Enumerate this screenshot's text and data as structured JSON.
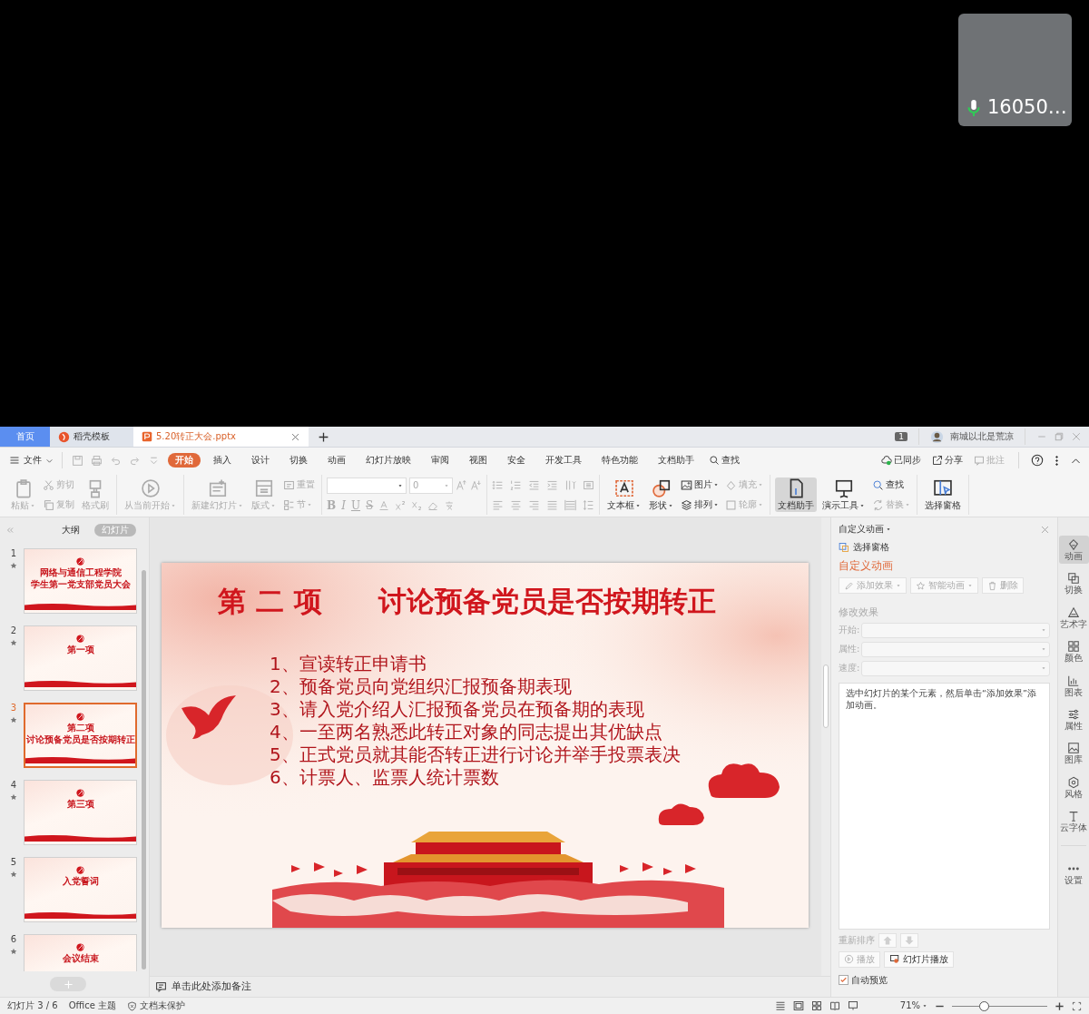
{
  "webcam": {
    "caption": "16050…"
  },
  "tabs": [
    {
      "label": "首页",
      "kind": "home",
      "selected": false
    },
    {
      "label": "稻壳模板",
      "kind": "docer",
      "selected": false
    },
    {
      "label": "5.20转正大会.pptx",
      "kind": "document",
      "selected": true
    }
  ],
  "account": {
    "badge": "1",
    "user": "南城以北是荒凉"
  },
  "menu": {
    "file": "文件",
    "items": [
      {
        "label": "开始",
        "selected": true
      },
      {
        "label": "插入",
        "selected": false
      },
      {
        "label": "设计",
        "selected": false
      },
      {
        "label": "切换",
        "selected": false
      },
      {
        "label": "动画",
        "selected": false
      },
      {
        "label": "幻灯片放映",
        "selected": false
      },
      {
        "label": "审阅",
        "selected": false
      },
      {
        "label": "视图",
        "selected": false
      },
      {
        "label": "安全",
        "selected": false
      },
      {
        "label": "开发工具",
        "selected": false
      },
      {
        "label": "特色功能",
        "selected": false
      },
      {
        "label": "文档助手",
        "selected": false
      }
    ],
    "search": "查找"
  },
  "menu_actions": [
    {
      "label": "已同步",
      "disabled": false
    },
    {
      "label": "分享",
      "disabled": false
    },
    {
      "label": "批注",
      "disabled": true
    }
  ],
  "ribbon": [
    {
      "kind": "buttons",
      "columns": [
        [
          {
            "label": "粘贴",
            "kind": "large",
            "disabled": true,
            "dropdown": true,
            "pressed": false
          }
        ],
        [
          {
            "label": "剪切",
            "kind": "small",
            "disabled": true,
            "dropdown": false,
            "pressed": false
          },
          {
            "label": "复制",
            "kind": "small",
            "disabled": true,
            "dropdown": false,
            "pressed": false
          }
        ],
        [
          {
            "label": "格式刷",
            "kind": "large",
            "disabled": true,
            "dropdown": false,
            "pressed": false
          }
        ]
      ]
    },
    {
      "kind": "buttons",
      "columns": [
        [
          {
            "label": "从当前开始",
            "kind": "large",
            "disabled": true,
            "dropdown": true,
            "pressed": false
          }
        ]
      ]
    },
    {
      "kind": "buttons",
      "columns": [
        [
          {
            "label": "新建幻灯片",
            "kind": "large",
            "disabled": true,
            "dropdown": true,
            "pressed": false
          }
        ],
        [
          {
            "label": "版式",
            "kind": "large",
            "disabled": true,
            "dropdown": true,
            "pressed": false
          }
        ],
        [
          {
            "label": "重置",
            "kind": "small",
            "disabled": true,
            "dropdown": false,
            "pressed": false
          },
          {
            "label": "节",
            "kind": "small",
            "disabled": true,
            "dropdown": true,
            "pressed": false
          }
        ]
      ]
    },
    {
      "kind": "font",
      "size_value": "0",
      "styles": [
        "B",
        "I",
        "U",
        "S"
      ]
    },
    {
      "kind": "paragraph"
    },
    {
      "kind": "buttons",
      "columns": [
        [
          {
            "label": "文本框",
            "kind": "large",
            "disabled": false,
            "dropdown": true,
            "pressed": false
          }
        ],
        [
          {
            "label": "形状",
            "kind": "large",
            "disabled": false,
            "dropdown": true,
            "pressed": false
          }
        ],
        [
          {
            "label": "图片",
            "kind": "small",
            "disabled": false,
            "dropdown": true,
            "pressed": false
          },
          {
            "label": "排列",
            "kind": "small",
            "disabled": false,
            "dropdown": true,
            "pressed": false
          }
        ],
        [
          {
            "label": "填充",
            "kind": "small",
            "disabled": true,
            "dropdown": true,
            "pressed": false
          },
          {
            "label": "轮廓",
            "kind": "small",
            "disabled": true,
            "dropdown": true,
            "pressed": false
          }
        ]
      ]
    },
    {
      "kind": "buttons",
      "columns": [
        [
          {
            "label": "文档助手",
            "kind": "large",
            "disabled": false,
            "dropdown": false,
            "pressed": true
          }
        ],
        [
          {
            "label": "演示工具",
            "kind": "large",
            "disabled": false,
            "dropdown": true,
            "pressed": false
          }
        ],
        [
          {
            "label": "查找",
            "kind": "small",
            "disabled": false,
            "dropdown": false,
            "pressed": false
          },
          {
            "label": "替换",
            "kind": "small",
            "disabled": true,
            "dropdown": true,
            "pressed": false
          }
        ]
      ]
    },
    {
      "kind": "buttons",
      "columns": [
        [
          {
            "label": "选择窗格",
            "kind": "large",
            "disabled": false,
            "dropdown": false,
            "pressed": false
          }
        ]
      ]
    }
  ],
  "outline_tabs": [
    {
      "label": "大纲",
      "selected": false
    },
    {
      "label": "幻灯片",
      "selected": true
    }
  ],
  "slides": [
    {
      "number": "1",
      "title": [
        "网络与通信工程学院",
        "学生第一党支部党员大会"
      ],
      "selected": false
    },
    {
      "number": "2",
      "title": [
        "第一项"
      ],
      "selected": false
    },
    {
      "number": "3",
      "title": [
        "第二项",
        "讨论预备党员是否按期转正"
      ],
      "selected": true
    },
    {
      "number": "4",
      "title": [
        "第三项"
      ],
      "selected": false
    },
    {
      "number": "5",
      "title": [
        "入党誓词"
      ],
      "selected": false
    },
    {
      "number": "6",
      "title": [
        "会议结束"
      ],
      "selected": false
    }
  ],
  "slide": {
    "heading": "第 二 项",
    "title": "讨论预备党员是否按期转正",
    "items": [
      "1、宣读转正申请书",
      "2、预备党员向党组织汇报预备期表现",
      "3、请入党介绍人汇报预备党员在预备期的表现",
      "4、一至两名熟悉此转正对象的同志提出其优缺点",
      "5、正式党员就其能否转正进行讨论并举手投票表决",
      "6、计票人、监票人统计票数"
    ]
  },
  "notes": {
    "placeholder": "单击此处添加备注"
  },
  "animation_pane": {
    "header": "自定义动画",
    "link": "选择窗格",
    "title": "自定义动画",
    "actions": [
      {
        "label": "添加效果",
        "disabled": true,
        "dropdown": true
      },
      {
        "label": "智能动画",
        "disabled": true,
        "dropdown": true
      },
      {
        "label": "删除",
        "disabled": true,
        "dropdown": false
      }
    ],
    "section": "修改效果",
    "fields": [
      {
        "label": "开始:",
        "disabled": true
      },
      {
        "label": "属性:",
        "disabled": true
      },
      {
        "label": "速度:",
        "disabled": true
      }
    ],
    "hint": "选中幻灯片的某个元素，然后单击“添加效果”添加动画。",
    "reorder": "重新排序",
    "play": {
      "label": "播放",
      "disabled": true
    },
    "slideshow": "幻灯片播放",
    "auto_preview": {
      "label": "自动预览",
      "checked": true
    }
  },
  "side_tabs": [
    {
      "label": "动画",
      "selected": true
    },
    {
      "label": "切换",
      "selected": false
    },
    {
      "label": "艺术字",
      "selected": false
    },
    {
      "label": "颜色",
      "selected": false
    },
    {
      "label": "图表",
      "selected": false
    },
    {
      "label": "属性",
      "selected": false
    },
    {
      "label": "图库",
      "selected": false
    },
    {
      "label": "风格",
      "selected": false
    },
    {
      "label": "云字体",
      "selected": false
    },
    {
      "label": "设置",
      "selected": false
    }
  ],
  "status_bar": {
    "slide": "幻灯片 3 / 6",
    "theme": "Office 主题",
    "protection": "文档未保护",
    "zoom": "71%",
    "zoom_slider": {
      "level": 0.33
    }
  }
}
